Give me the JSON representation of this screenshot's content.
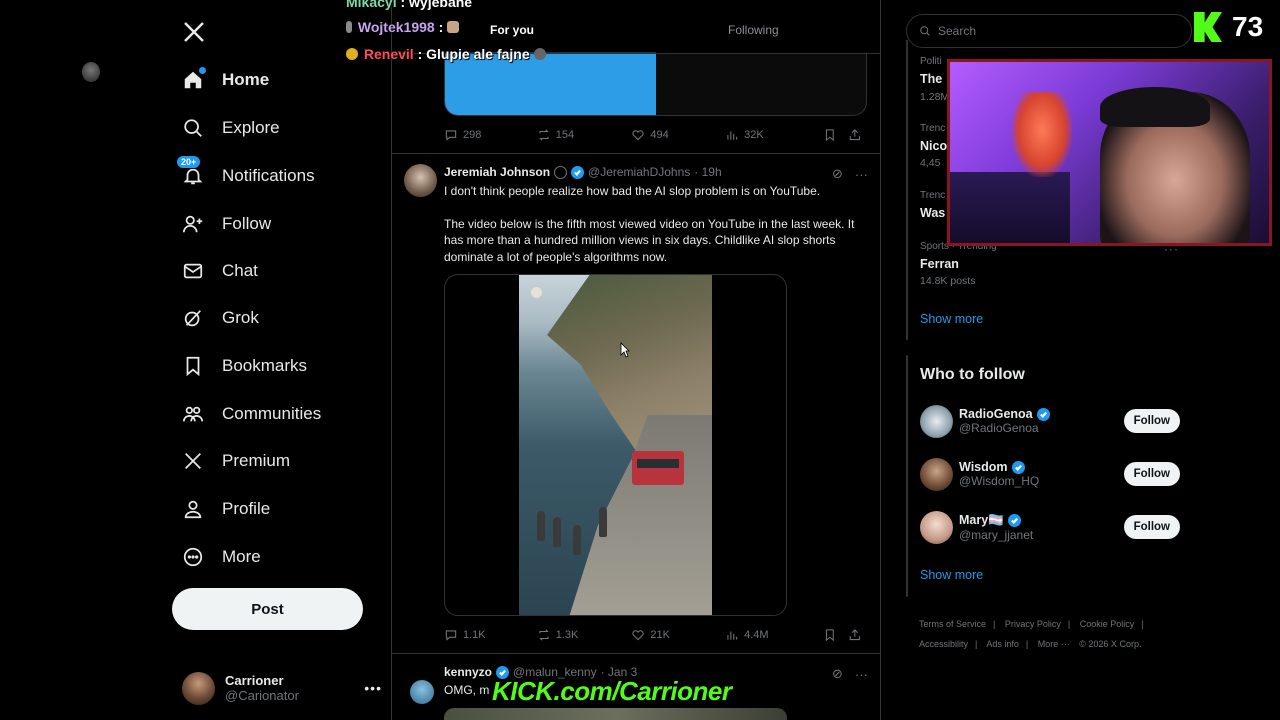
{
  "nav": {
    "items": [
      {
        "label": "Home",
        "icon": "home-icon"
      },
      {
        "label": "Explore",
        "icon": "search-icon"
      },
      {
        "label": "Notifications",
        "icon": "bell-icon",
        "badge": "20+"
      },
      {
        "label": "Follow",
        "icon": "person-plus-icon"
      },
      {
        "label": "Chat",
        "icon": "mail-icon"
      },
      {
        "label": "Grok",
        "icon": "grok-icon"
      },
      {
        "label": "Bookmarks",
        "icon": "bookmark-icon"
      },
      {
        "label": "Communities",
        "icon": "communities-icon"
      },
      {
        "label": "Premium",
        "icon": "x-logo-icon"
      },
      {
        "label": "Profile",
        "icon": "profile-icon"
      },
      {
        "label": "More",
        "icon": "more-circle-icon"
      }
    ],
    "post_label": "Post",
    "account": {
      "name": "Carrioner",
      "handle": "@Carionator"
    }
  },
  "tabs": {
    "for_you": "For you",
    "following": "Following"
  },
  "prev_tweet_actions": {
    "replies": "298",
    "reposts": "154",
    "likes": "494",
    "views": "32K"
  },
  "tweet": {
    "name": "Jeremiah Johnson",
    "handle": "@JeremiahDJohns",
    "time": "· 19h",
    "text1": "I don't think people realize how bad the AI slop problem is on YouTube.",
    "text2": "The video below is the fifth most viewed video on YouTube in the last week. It has more than a hundred million views in six days. Childlike AI slop shorts dominate a lot of people's algorithms now.",
    "actions": {
      "replies": "1.1K",
      "reposts": "1.3K",
      "likes": "21K",
      "views": "4.4M"
    }
  },
  "tweet2": {
    "name": "kennyzo",
    "handle": "@malun_kenny",
    "time": "· Jan 3",
    "text": "OMG, m"
  },
  "right": {
    "search_placeholder": "Search",
    "trends": [
      {
        "category": "Politi",
        "name": "The",
        "posts": "1.28M"
      },
      {
        "category": "Trenc",
        "name": "Nico",
        "posts": "4,45"
      },
      {
        "category": "Trenc",
        "name": "Was",
        "posts": ""
      },
      {
        "category": "Sports · Trending",
        "name": "Ferran",
        "posts": "14.8K posts"
      }
    ],
    "show_more": "Show more",
    "who_to_follow": "Who to follow",
    "follow_suggestions": [
      {
        "name": "RadioGenoa",
        "handle": "@RadioGenoa",
        "button": "Follow"
      },
      {
        "name": "Wisdom",
        "handle": "@Wisdom_HQ",
        "button": "Follow"
      },
      {
        "name": "Mary🏳️‍⚧️",
        "handle": "@mary_jjanet",
        "button": "Follow"
      }
    ],
    "footer": [
      "Terms of Service",
      "|",
      "Privacy Policy",
      "|",
      "Cookie Policy",
      "|",
      "Accessibility",
      "|",
      "Ads info",
      "|",
      "More ···",
      "© 2026 X Corp."
    ]
  },
  "overlay": {
    "chat": [
      {
        "user": "Mikacyl",
        "message": ": wyjebane"
      },
      {
        "user": "Wojtek1998",
        "message": ":"
      },
      {
        "user": "Renevil",
        "message": ": Glupie ale fajne"
      }
    ],
    "kick_count": "73",
    "kick_url": "KICK.com/Carrioner"
  }
}
